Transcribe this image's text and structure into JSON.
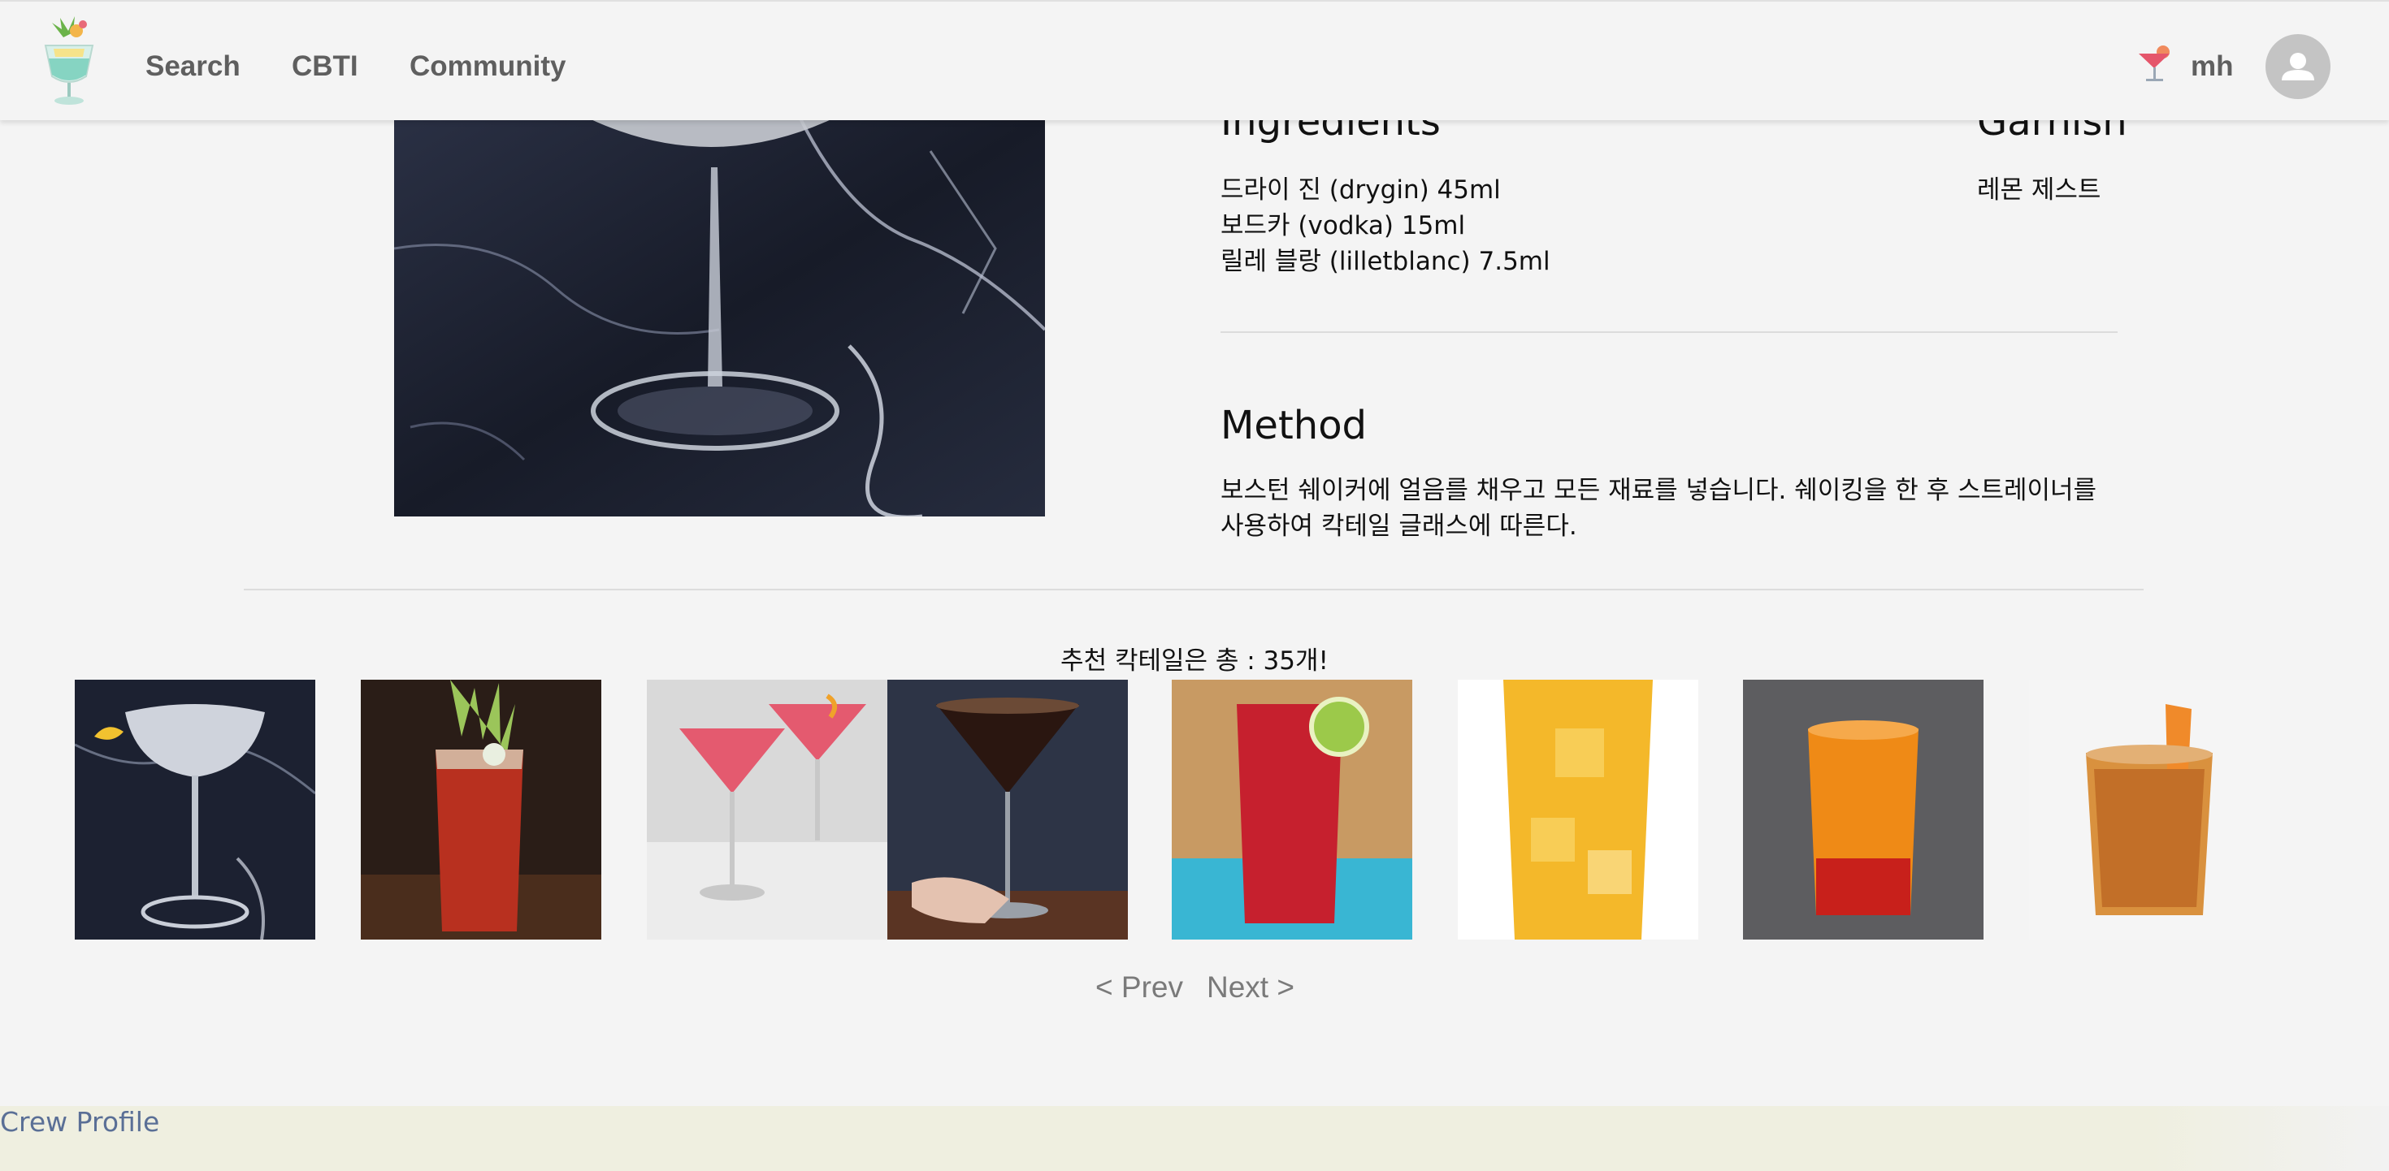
{
  "nav": {
    "links": [
      "Search",
      "CBTI",
      "Community"
    ],
    "username": "mh"
  },
  "detail": {
    "ingredients_title": "Ingredients",
    "ingredients": [
      "드라이 진 (drygin) 45ml",
      "보드카 (vodka) 15ml",
      "릴레 블랑 (lilletblanc) 7.5ml"
    ],
    "garnish_title": "Garnish",
    "garnish": "레몬 제스트",
    "method_title": "Method",
    "method": "보스턴 쉐이커에 얼음를 채우고 모든 재료를 넣습니다. 쉐이킹을 한 후 스트레이너를 사용하여 칵테일 글래스에 따른다."
  },
  "recommend": {
    "count_text": "추천 칵테일은 총 : 35개!",
    "prev_label": "< Prev",
    "next_label": "Next >"
  },
  "footer": {
    "link": "Crew Profile"
  }
}
